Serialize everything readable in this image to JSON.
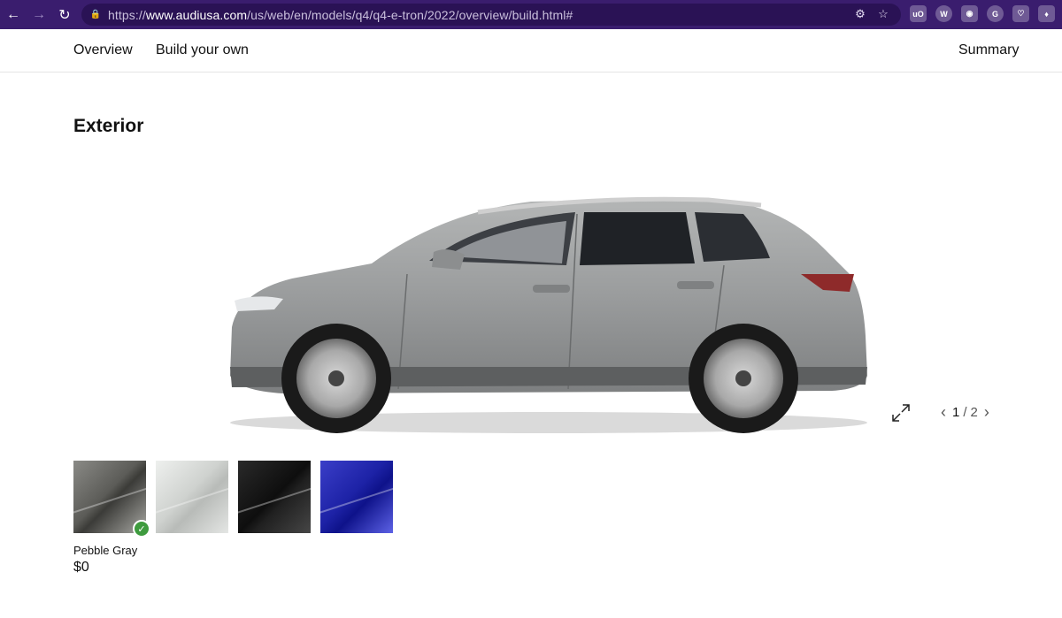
{
  "browser": {
    "url_prefix": "https://",
    "url_host": "www.audiusa.com",
    "url_path": "/us/web/en/models/q4/q4-e-tron/2022/overview/build.html#"
  },
  "nav": {
    "overview": "Overview",
    "build": "Build your own",
    "summary": "Summary"
  },
  "section": {
    "title": "Exterior"
  },
  "gallery": {
    "current": "1",
    "separator": "/",
    "total": "2"
  },
  "selected_color": {
    "name": "Pebble Gray",
    "price": "$0"
  },
  "swatches": [
    "pebble-gray",
    "silver",
    "black",
    "blue"
  ]
}
